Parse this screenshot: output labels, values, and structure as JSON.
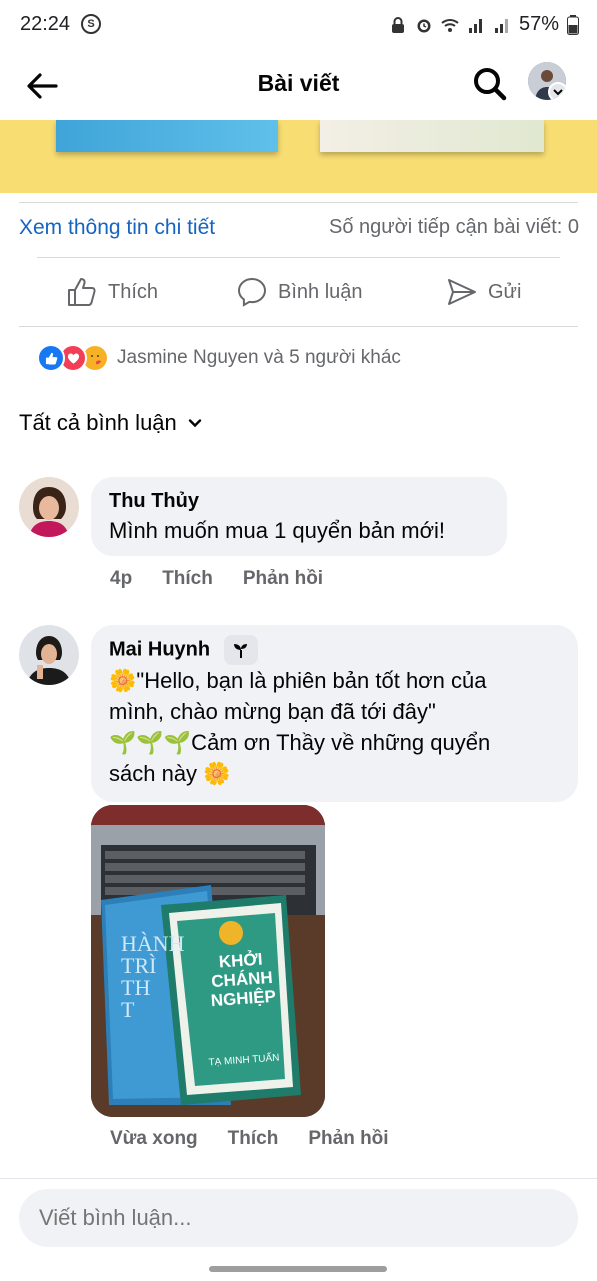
{
  "status_bar": {
    "time": "22:24",
    "battery": "57%",
    "icons": [
      "s-app-icon",
      "lock-icon",
      "alarm-icon",
      "wifi-icon",
      "signal-icon",
      "signal-icon",
      "battery-icon"
    ]
  },
  "header": {
    "title": "Bài viết",
    "back_icon": "back-arrow-icon",
    "search_icon": "search-icon"
  },
  "post_info": {
    "detail_link": "Xem thông tin chi tiết",
    "reach_text": "Số người tiếp cận bài viết: 0"
  },
  "actions": {
    "like": "Thích",
    "comment": "Bình luận",
    "send": "Gửi"
  },
  "reactions": {
    "text": "Jasmine Nguyen và 5 người khác",
    "types": [
      "like-icon",
      "love-icon",
      "care-icon"
    ]
  },
  "comments_filter": {
    "label": "Tất cả bình luận"
  },
  "comments": [
    {
      "name": "Thu Thủy",
      "text": "Mình muốn mua 1 quyển bản mới!",
      "time": "4p",
      "like": "Thích",
      "reply": "Phản hồi"
    },
    {
      "name": "Mai Huynh",
      "badge_icon": "sprout-icon",
      "line1": "🌼\"Hello, bạn là phiên bản tốt hơn của",
      "line2": "mình, chào mừng bạn đã tới đây\"",
      "line3": "🌱🌱🌱Cảm ơn Thầy về những quyển",
      "line4": "sách này 🌼",
      "time": "Vừa xong",
      "like": "Thích",
      "reply": "Phản hồi",
      "photo": {
        "book_title_1": "HÀNH",
        "book_title_2": "TRÌ",
        "book_title_3": "TH",
        "book_title_4": "T",
        "book2_line1": "KHỞI",
        "book2_line2": "CHÁNH",
        "book2_line3": "NGHIỆP",
        "book2_author": "TẠ MINH TUẤN"
      }
    }
  ],
  "composer": {
    "placeholder": "Viết bình luận..."
  }
}
